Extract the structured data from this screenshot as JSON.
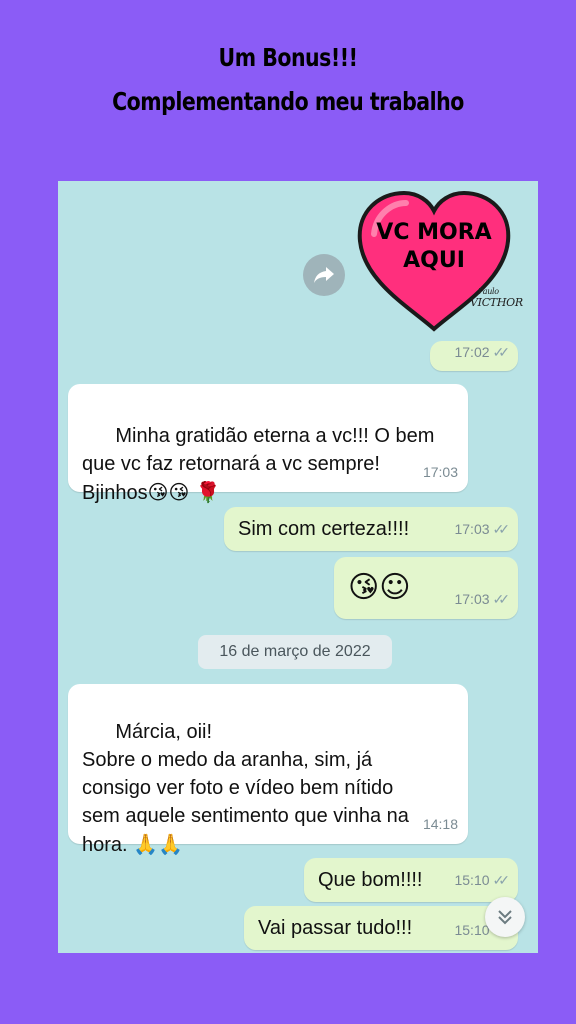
{
  "header": {
    "line1": "Um Bonus!!!",
    "line2": "Complementando meu trabalho"
  },
  "sticker": {
    "line1": "VC MORA",
    "line2": "AQUI",
    "signature": "VICTHOR",
    "signature_top": "Paulo"
  },
  "messages": [
    {
      "dir": "out",
      "time": "17:02",
      "ticks": "✓✓"
    },
    {
      "dir": "in",
      "text": "Minha gratidão eterna a vc!!! O bem\nque vc faz retornará a vc sempre!\nBjinhos",
      "emoji": "😘😘 🌹",
      "time": "17:03"
    },
    {
      "dir": "out",
      "text": "Sim com certeza!!!!",
      "time": "17:03",
      "ticks": "✓✓"
    },
    {
      "dir": "out",
      "emoji": "😘☺",
      "time": "17:03",
      "ticks": "✓✓"
    },
    {
      "dir": "in",
      "text": "Márcia, oii!\nSobre o medo da aranha, sim, já\nconsigo ver foto e vídeo bem nítido\nsem aquele sentimento que vinha na\nhora.",
      "emoji": "🙏🙏",
      "time": "14:18"
    },
    {
      "dir": "out",
      "text": "Que bom!!!!",
      "time": "15:10",
      "ticks": "✓✓"
    },
    {
      "dir": "out",
      "text": "Vai passar tudo!!!",
      "time": "15:10",
      "ticks": "✓✓"
    }
  ],
  "date_chip": "16 de março de 2022",
  "icons": {
    "forward": "forward-icon",
    "scroll": "double-chevron-down-icon"
  },
  "colors": {
    "background": "#8b5cf6",
    "chat_bg": "#b9e3e6",
    "incoming": "#ffffff",
    "outgoing": "#e3f6cd",
    "heart": "#ff2f7d"
  }
}
